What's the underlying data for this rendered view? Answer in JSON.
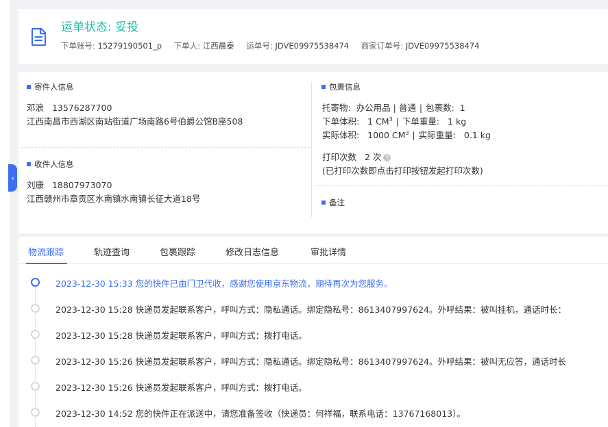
{
  "collapse_glyph": "‹",
  "header": {
    "title": "运单状态: 妥投",
    "meta": [
      {
        "label": "下单账号:",
        "value": "15279190501_p"
      },
      {
        "label": "下单人:",
        "value": "江西晨泰"
      },
      {
        "label": "运单号:",
        "value": "JDVE09975538474"
      },
      {
        "label": "商家订单号:",
        "value": "JDVE09975538474"
      }
    ],
    "icon": "document-icon",
    "title_color": "#1fbfa5"
  },
  "sender": {
    "title": "寄件人信息",
    "name": "邓浪",
    "phone": "13576287700",
    "address": "江西南昌市西湖区南站街道广场南路6号伯爵公馆B座508"
  },
  "receiver": {
    "title": "收件人信息",
    "name": "刘康",
    "phone": "18807973070",
    "address": "江西赣州市章贡区水南镇水南镇长征大道18号"
  },
  "package": {
    "title": "包裹信息",
    "goods_label": "托寄物:",
    "goods_value": "办公用品 | 普通",
    "count_label": "包裹数:",
    "count_value": "1",
    "order_volume_label": "下单体积:",
    "order_volume_value": "1 CM",
    "order_weight_label": "下单重量:",
    "order_weight_value": "1 kg",
    "actual_volume_label": "实际体积:",
    "actual_volume_value": "1000 CM",
    "actual_weight_label": "实际重量:",
    "actual_weight_value": "0.1 kg",
    "cube_sup": "3",
    "separator": "|",
    "print_label": "打印次数",
    "print_value": "2 次",
    "print_help_glyph": "?",
    "print_note": "(已打印次数即点击打印按钮发起打印次数)"
  },
  "remark": {
    "title": "备注"
  },
  "tabs": [
    "物流跟踪",
    "轨迹查询",
    "包裹跟踪",
    "修改日志信息",
    "审批详情"
  ],
  "timeline": [
    "2023-12-30 15:33 您的快件已由门卫代收，感谢您使用京东物流，期待再次为您服务。",
    "2023-12-30 15:28 快递员发起联系客户，呼叫方式：隐私通话。绑定隐私号：8613407997624。外呼结果：被叫挂机，通话时长：",
    "2023-12-30 15:28 快递员发起联系客户，呼叫方式：拨打电话。",
    "2023-12-30 15:26 快递员发起联系客户，呼叫方式：隐私通话。绑定隐私号：8613407997624。外呼结果：被叫无应答，通话时长",
    "2023-12-30 15:26 快递员发起联系客户，呼叫方式：拨打电话。",
    "2023-12-30 14:52 您的快件正在派送中，请您准备签收（快递员：何祥福，联系电话：13767168013）。"
  ],
  "colors": {
    "accent": "#3c6ff0",
    "status_green": "#1fbfa5"
  }
}
